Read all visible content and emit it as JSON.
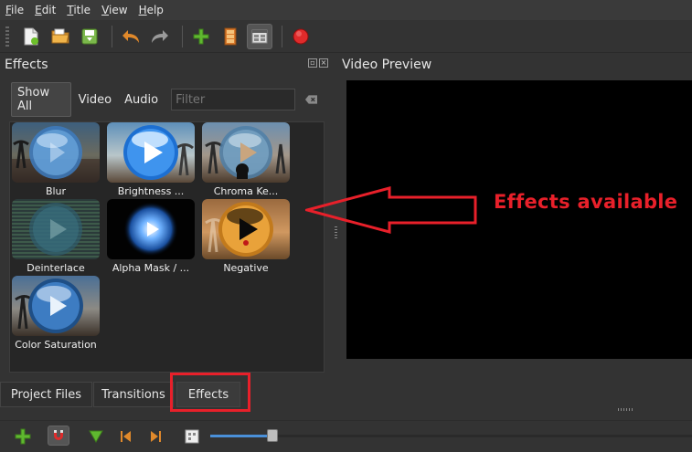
{
  "menu": {
    "file": "File",
    "edit": "Edit",
    "title": "Title",
    "view": "View",
    "help": "Help"
  },
  "toolbar": {
    "icons": [
      "new-project-icon",
      "open-project-icon",
      "save-project-icon",
      "undo-icon",
      "redo-icon",
      "import-files-icon",
      "profile-icon",
      "fullscreen-icon",
      "export-video-icon"
    ]
  },
  "effects_panel": {
    "title": "Effects",
    "filters": {
      "show_all": "Show All",
      "video": "Video",
      "audio": "Audio"
    },
    "filter_placeholder": "Filter",
    "items": [
      {
        "label": "Blur"
      },
      {
        "label": "Brightness ..."
      },
      {
        "label": "Chroma Ke..."
      },
      {
        "label": "Deinterlace"
      },
      {
        "label": "Alpha Mask / ..."
      },
      {
        "label": "Negative"
      },
      {
        "label": "Color Saturation"
      }
    ]
  },
  "preview": {
    "title": "Video Preview"
  },
  "annotation": {
    "text": "Effects available",
    "color": "#e8202a"
  },
  "tabs": [
    {
      "label": "Project Files"
    },
    {
      "label": "Transitions"
    },
    {
      "label": "Effects"
    }
  ],
  "colors": {
    "accent": "#4a90d9",
    "background": "#333333",
    "annotation_red": "#e8202a"
  }
}
